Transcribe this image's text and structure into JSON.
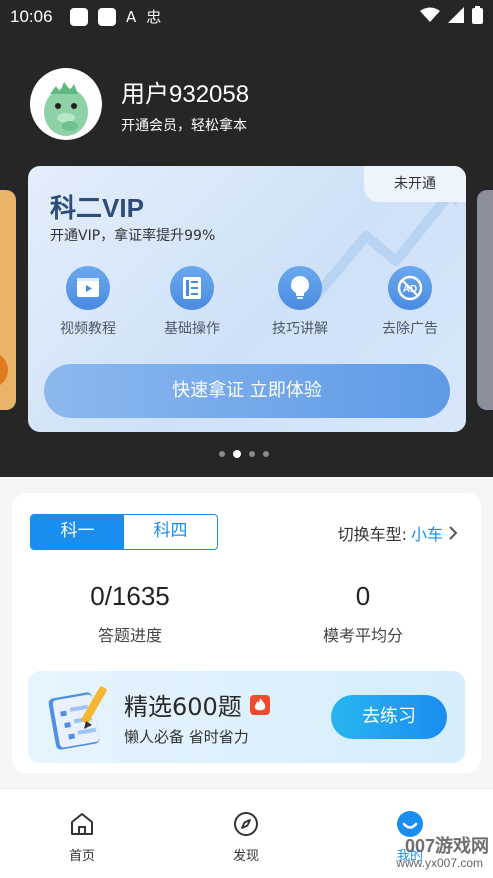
{
  "status_bar": {
    "time": "10:06",
    "glyph_a": "A",
    "glyph_b": "忠"
  },
  "profile": {
    "username": "用户932058",
    "subtitle": "开通会员，轻松拿本"
  },
  "vip_card": {
    "badge": "未开通",
    "title": "科二VIP",
    "subtitle": "开通VIP，拿证率提升99%",
    "features": [
      {
        "label": "视频教程",
        "icon": "video-icon"
      },
      {
        "label": "基础操作",
        "icon": "film-icon"
      },
      {
        "label": "技巧讲解",
        "icon": "bulb-icon"
      },
      {
        "label": "去除广告",
        "icon": "no-ad-icon"
      }
    ],
    "cta": "快速拿证 立即体验",
    "accent": "#4a8be0"
  },
  "carousel": {
    "active_index": 1,
    "count": 4
  },
  "subjects": {
    "tabs": [
      "科一",
      "科四"
    ],
    "active_tab": 0,
    "switch_label": "切换车型:",
    "car_type": "小车",
    "progress_value": "0/1635",
    "progress_label": "答题进度",
    "avg_value": "0",
    "avg_label": "模考平均分"
  },
  "practice": {
    "title": "精选600题",
    "subtitle": "懒人必备 省时省力",
    "button": "去练习"
  },
  "bottom_nav": [
    {
      "label": "首页",
      "icon": "home-icon"
    },
    {
      "label": "发现",
      "icon": "compass-icon"
    },
    {
      "label": "我的",
      "icon": "profile-icon"
    }
  ],
  "watermark": {
    "text": "007游戏网",
    "url": "www.yx007.com"
  },
  "colors": {
    "primary": "#1a8df0",
    "dark_bg": "#262626",
    "hot": "#f0492e"
  }
}
